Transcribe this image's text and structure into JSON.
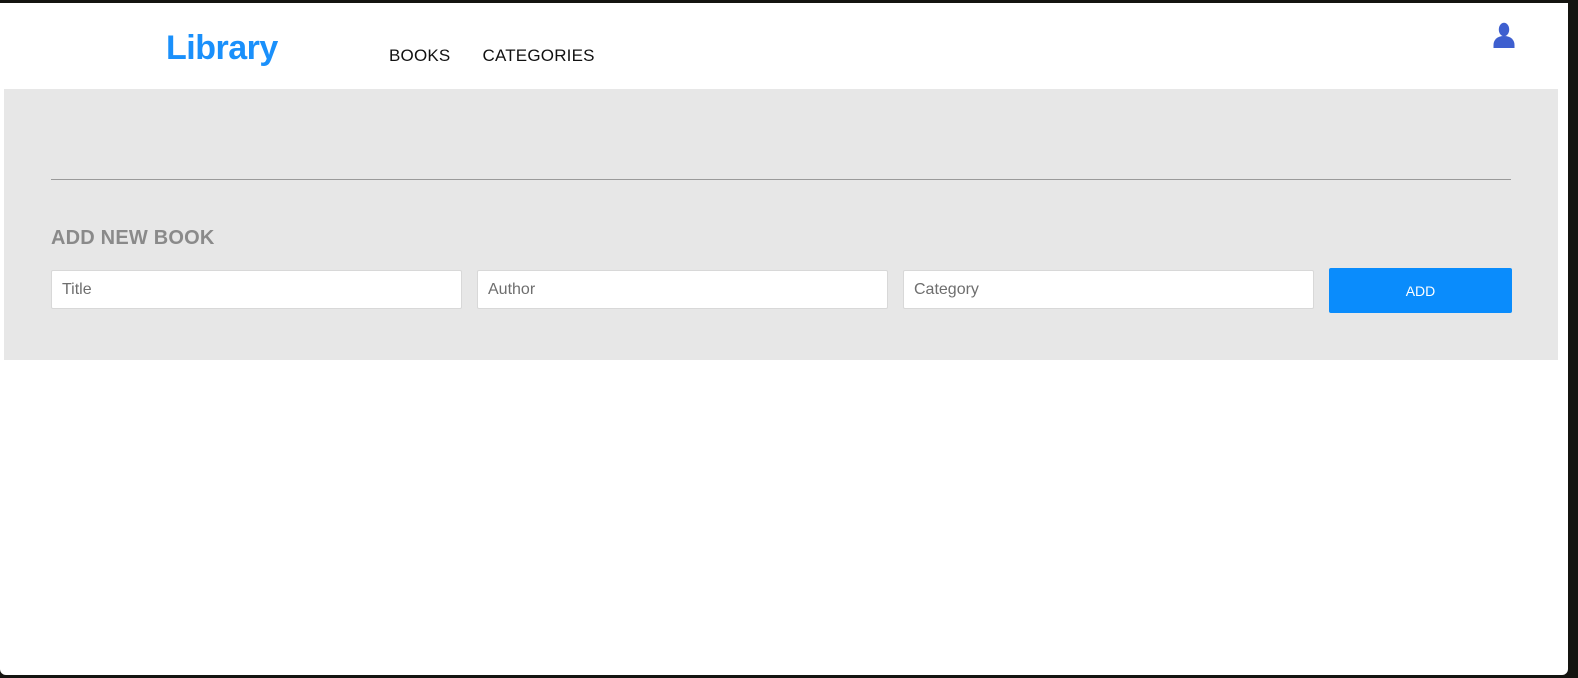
{
  "header": {
    "logo": "Library",
    "nav": [
      {
        "label": "BOOKS"
      },
      {
        "label": "CATEGORIES"
      }
    ],
    "user_icon": "user-silhouette-icon"
  },
  "form": {
    "title": "ADD NEW BOOK",
    "title_placeholder": "Title",
    "author_placeholder": "Author",
    "category_placeholder": "Category",
    "add_label": "ADD"
  },
  "colors": {
    "brand": "#1a90fb",
    "button": "#0a8cfc",
    "panel": "#e7e7e7",
    "user_icon": "#3e5fcf"
  }
}
